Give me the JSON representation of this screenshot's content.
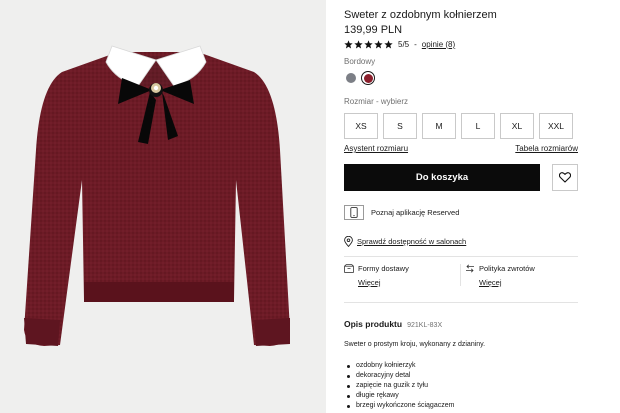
{
  "product": {
    "title": "Sweter z ozdobnym kołnierzem",
    "price": "139,99 PLN",
    "rating": {
      "stars": 5,
      "score": "5/5",
      "separator": "-",
      "reviews": "opinie (8)"
    }
  },
  "colors": {
    "label": "Bordowy",
    "options": [
      {
        "name": "grey",
        "hex": "#7c7f86"
      },
      {
        "name": "bordowy",
        "hex": "#8a1f2c",
        "selected": true
      }
    ]
  },
  "sizes": {
    "label": "Rozmiar -  wybierz",
    "options": [
      "XS",
      "S",
      "M",
      "L",
      "XL",
      "XXL"
    ],
    "assistant_link": "Asystent rozmiaru",
    "table_link": "Tabela rozmiarów"
  },
  "actions": {
    "add_to_cart": "Do koszyka",
    "wishlist_icon": "heart-icon"
  },
  "app_promo": {
    "text": "Poznaj aplikację Reserved",
    "icon": "phone-icon"
  },
  "store_check": {
    "text": "Sprawdź dostępność w salonach",
    "icon": "location-pin-icon"
  },
  "delivery": {
    "shipping_label": "Formy dostawy",
    "shipping_more": "Więcej",
    "returns_label": "Polityka zwrotów",
    "returns_more": "Więcej"
  },
  "description": {
    "title": "Opis produktu",
    "code": "921KL-83X",
    "text": "Sweter o prostym kroju, wykonany z dzianiny.",
    "features": [
      "ozdobny kołnierzyk",
      "dekoracyjny detal",
      "zapięcie na guzik z tyłu",
      "długie rękawy",
      "brzegi wykończone ściągaczem"
    ]
  },
  "theme": {
    "sweater": "#6b1a24",
    "accent_dark": "#0b0b0b"
  }
}
